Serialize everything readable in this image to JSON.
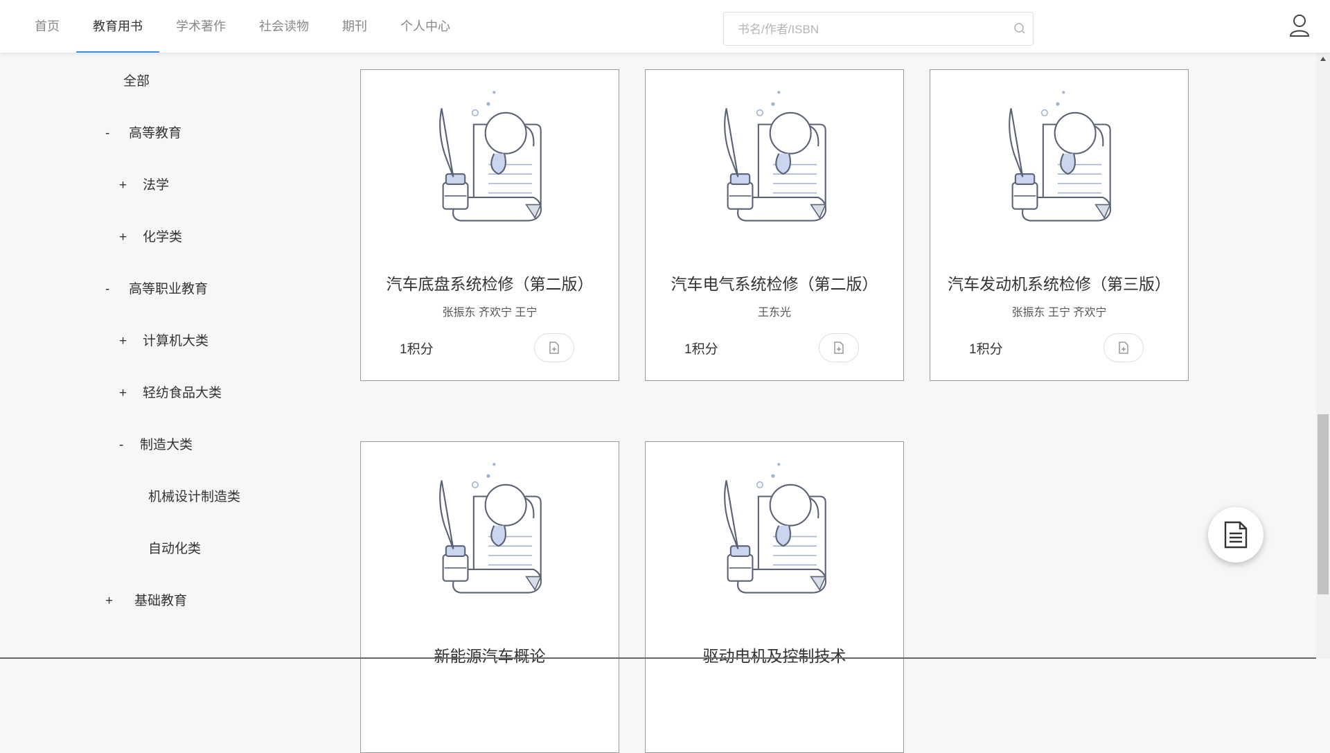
{
  "nav": {
    "items": [
      {
        "label": "首页"
      },
      {
        "label": "教育用书"
      },
      {
        "label": "学术著作"
      },
      {
        "label": "社会读物"
      },
      {
        "label": "期刊"
      },
      {
        "label": "个人中心"
      }
    ],
    "active": "教育用书"
  },
  "search": {
    "placeholder": "书名/作者/ISBN",
    "value": ""
  },
  "sidebar": {
    "items": [
      {
        "label": "全部",
        "sign": ""
      },
      {
        "label": "高等教育",
        "sign": "-"
      },
      {
        "label": "法学",
        "sign": "+"
      },
      {
        "label": "化学类",
        "sign": "+"
      },
      {
        "label": "高等职业教育",
        "sign": "-"
      },
      {
        "label": "计算机大类",
        "sign": "+"
      },
      {
        "label": "轻纺食品大类",
        "sign": "+"
      },
      {
        "label": "制造大类",
        "sign": "-"
      },
      {
        "label": "机械设计制造类",
        "sign": ""
      },
      {
        "label": "自动化类",
        "sign": ""
      },
      {
        "label": "基础教育",
        "sign": "+"
      }
    ]
  },
  "books": [
    {
      "title": "汽车底盘系统检修（第二版）",
      "authors": "张振东 齐欢宁 王宁",
      "points": "1积分"
    },
    {
      "title": "汽车电气系统检修（第二版）",
      "authors": "王东光",
      "points": "1积分"
    },
    {
      "title": "汽车发动机系统检修（第三版）",
      "authors": "张振东 王宁 齐欢宁",
      "points": "1积分"
    },
    {
      "title": "新能源汽车概论",
      "authors": "",
      "points": ""
    },
    {
      "title": "驱动电机及控制技术",
      "authors": "",
      "points": ""
    }
  ],
  "icons": {
    "search": "search-icon",
    "user": "user-icon",
    "book_button": "document-icon",
    "fab": "document-list-icon"
  },
  "colors": {
    "accent": "#3a8ee6"
  }
}
